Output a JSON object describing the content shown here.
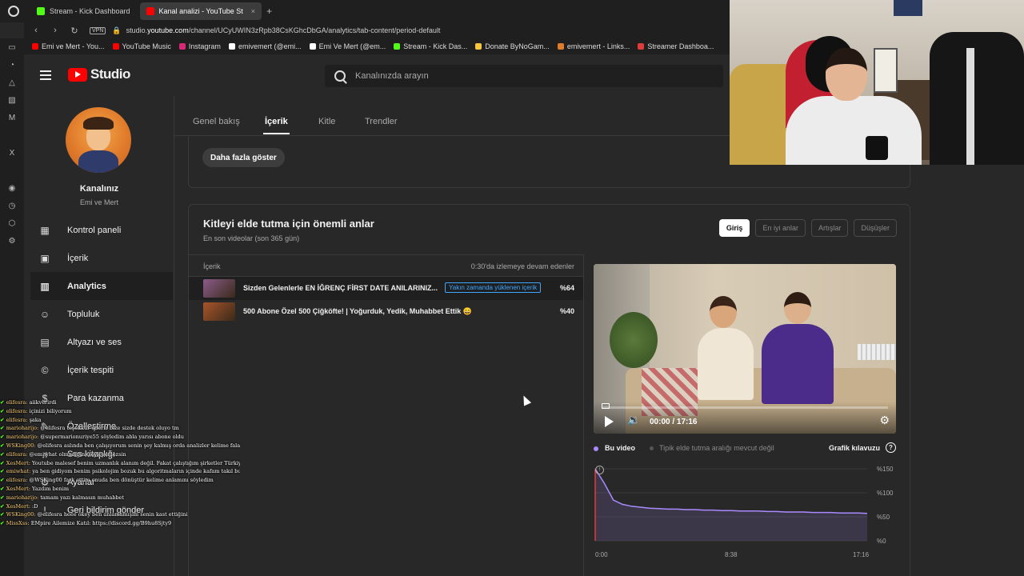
{
  "browser": {
    "tabs": [
      {
        "label": "Stream - Kick Dashboard",
        "color": "#53fc18",
        "active": false
      },
      {
        "label": "Kanal analizi - YouTube St",
        "color": "#ff0000",
        "active": true
      }
    ],
    "url_prefix": "studio.",
    "url_host": "youtube.com",
    "url_path": "/channel/UCyUWIN3zRpb38CsKGhcDbGA/analytics/tab-content/period-default",
    "vpn_label": "VPN",
    "bookmarks": [
      {
        "label": "Emi ve Mert - You...",
        "color": "#ff0000"
      },
      {
        "label": "YouTube Music",
        "color": "#ff0000"
      },
      {
        "label": "Instagram",
        "color": "#d62976"
      },
      {
        "label": "emivemert (@emi...",
        "color": "#ffffff"
      },
      {
        "label": "Emi Ve Mert (@em...",
        "color": "#ffffff"
      },
      {
        "label": "Stream - Kick Das...",
        "color": "#53fc18"
      },
      {
        "label": "Donate ByNoGam...",
        "color": "#f5c542"
      },
      {
        "label": "emivemert - Links...",
        "color": "#e07b2b"
      },
      {
        "label": "Streamer Dashboa...",
        "color": "#e03a3a"
      }
    ]
  },
  "studio": {
    "logo_text": "Studio",
    "search_placeholder": "Kanalınızda arayın",
    "channel": {
      "name": "Kanalınız",
      "handle": "Emi ve Mert"
    },
    "nav": [
      {
        "label": "Kontrol paneli",
        "icon": "dashboard-icon",
        "glyph": "▦",
        "active": false
      },
      {
        "label": "İçerik",
        "icon": "content-icon",
        "glyph": "▣",
        "active": false
      },
      {
        "label": "Analytics",
        "icon": "analytics-icon",
        "glyph": "▥",
        "active": true
      },
      {
        "label": "Topluluk",
        "icon": "community-icon",
        "glyph": "☺",
        "active": false
      },
      {
        "label": "Altyazı ve ses",
        "icon": "subtitles-icon",
        "glyph": "▤",
        "active": false
      },
      {
        "label": "İçerik tespiti",
        "icon": "copyright-icon",
        "glyph": "©",
        "active": false
      },
      {
        "label": "Para kazanma",
        "icon": "monetization-icon",
        "glyph": "$",
        "active": false
      },
      {
        "label": "Özelleştirme",
        "icon": "customization-icon",
        "glyph": "✎",
        "active": false
      },
      {
        "label": "Ses kitaplığı",
        "icon": "audio-library-icon",
        "glyph": "♫",
        "active": false
      },
      {
        "label": "Ayarlar",
        "icon": "settings-icon",
        "glyph": "⚙",
        "active": false
      },
      {
        "label": "Geri bildirim gönder",
        "icon": "feedback-icon",
        "glyph": "!",
        "active": false
      }
    ],
    "tabs": [
      {
        "label": "Genel bakış",
        "active": false
      },
      {
        "label": "İçerik",
        "active": true
      },
      {
        "label": "Kitle",
        "active": false
      },
      {
        "label": "Trendler",
        "active": false
      }
    ],
    "show_more_label": "Daha fazla göster",
    "moments": {
      "title": "Kitleyi elde tutma için önemli anlar",
      "subtitle": "En son videolar (son 365 gün)",
      "chips": [
        {
          "label": "Giriş",
          "active": true
        },
        {
          "label": "En iyi anlar",
          "active": false
        },
        {
          "label": "Artışlar",
          "active": false
        },
        {
          "label": "Düşüşler",
          "active": false
        }
      ],
      "col_content": "İçerik",
      "col_metric": "0:30'da izlemeye devam edenler",
      "rows": [
        {
          "title": "Sizden Gelenlerle EN İĞRENÇ FİRST DATE ANILARINIZ...",
          "badge": "Yakın zamanda yüklenen içerik",
          "pct": "%64",
          "thumb": "#8a5b8a"
        },
        {
          "title": "500 Abone Özel 500 Çiğköfte! | Yoğurduk, Yedik, Muhabbet Ettik 😄",
          "badge": "",
          "pct": "%40",
          "thumb": "#a8552a"
        }
      ],
      "player": {
        "time": "00:00 / 17:16"
      },
      "legend": {
        "this_video": "Bu video",
        "typical": "Tipik elde tutma aralığı mevcut değil",
        "guide": "Grafik kılavuzu"
      }
    }
  },
  "chart_data": {
    "type": "line",
    "series": [
      {
        "values": [
          150,
          120,
          85,
          76,
          72,
          70,
          68,
          67,
          66,
          66,
          65,
          65,
          64,
          64,
          63,
          63,
          62,
          62,
          62,
          61,
          61,
          60,
          60,
          60,
          59,
          59,
          59,
          58,
          58,
          58,
          57
        ]
      }
    ],
    "x": [
      "0:00",
      "",
      "",
      "",
      "",
      "",
      "",
      "",
      "",
      "",
      "",
      "",
      "",
      "",
      "",
      "8:38",
      "",
      "",
      "",
      "",
      "",
      "",
      "",
      "",
      "",
      "",
      "",
      "",
      "",
      "",
      "17:16"
    ],
    "xticks": [
      "0:00",
      "8:38",
      "17:16"
    ],
    "yticks": [
      "%150",
      "%100",
      "%50",
      "%0"
    ],
    "ylim": [
      0,
      150
    ],
    "color": "#a98bff"
  },
  "chat": [
    {
      "user": "elifesra:",
      "text": "aiikverirdi"
    },
    {
      "user": "elifesra:",
      "text": "içinizi biliyorum"
    },
    {
      "user": "elifesra:",
      "text": "şaka"
    },
    {
      "user": "marioharijo:",
      "text": "@elifesra teşekkür ederiz bize sizde destek oluyo tm"
    },
    {
      "user": "marioharijo:",
      "text": "@supermarionuriye55 söyledim abla yarısı abone oldu"
    },
    {
      "user": "WSKing00:",
      "text": "@elifesra aslında ben çalışıyorum senin şey kalmış orda analizler kelime falan diye yazmışım bir şeyler takma beni bazenleri ben boş yapabiliyorum"
    },
    {
      "user": "elifesra:",
      "text": "@emiwhat olmadığını söyleyemezsin"
    },
    {
      "user": "XesMert:",
      "text": "Youtube malesef benim uzmanlık alanım değil. Fakat çalıştığım şirketler Türkiye'nin en iyi sosyal medya uzmanları ile çalışıyordu. Hiç kaç aklımda kalan var sadece :D"
    },
    {
      "user": "emiwhat:",
      "text": "ya ben gidiyom benim psikolojim bozuk bu algoritmaların içinde kafam takıl bu istatistik bakmak"
    },
    {
      "user": "elifesra:",
      "text": "@WSKing00 fark ettim onuda ben dönüştür kelime anlamını söyledim"
    },
    {
      "user": "XesMert:",
      "text": "Yazdım benim"
    },
    {
      "user": "marioharijo:",
      "text": "tamam yazı kalmasın muhabbet"
    },
    {
      "user": "XesMert:",
      "text": ":D"
    },
    {
      "user": "WSKing00:",
      "text": "@elifesra heee okey ben anlamamışım senin kast ettiğini"
    },
    {
      "user": "MissXss:",
      "text": "EMpire Ailemize Katıl: https://discord.gg/B9hu8Sjty9"
    }
  ]
}
